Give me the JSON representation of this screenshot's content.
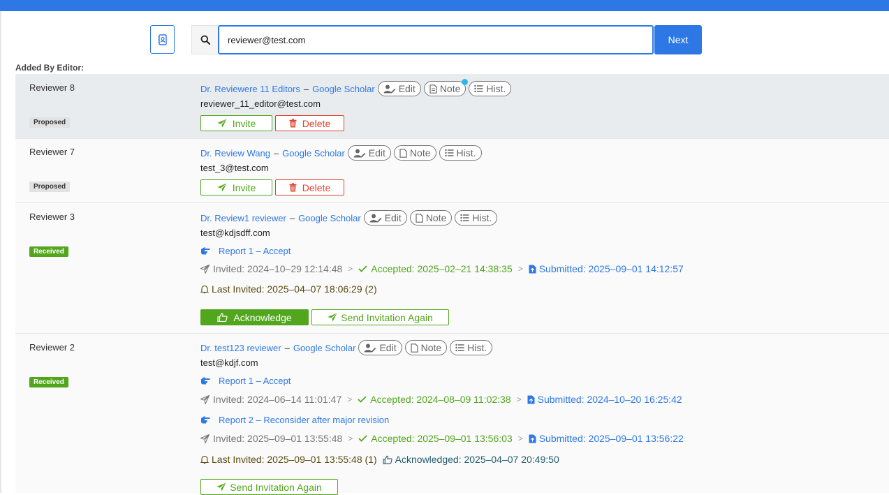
{
  "search": {
    "value": "reviewer@test.com",
    "next_label": "Next"
  },
  "section_label": "Added By Editor:",
  "common": {
    "google_scholar": "Google Scholar",
    "dash": "–",
    "edit": "Edit",
    "note": "Note",
    "hist": "Hist.",
    "invite": "Invite",
    "delete": "Delete",
    "acknowledge": "Acknowledge",
    "send_again": "Send Invitation Again"
  },
  "reviewers": [
    {
      "label": "Reviewer 8",
      "status": "Proposed",
      "name": "Dr. Reviewere 11 Editors",
      "email": "reviewer_11_editor@test.com"
    },
    {
      "label": "Reviewer 7",
      "status": "Proposed",
      "name": "Dr. Review Wang",
      "email": "test_3@test.com"
    },
    {
      "label": "Reviewer 3",
      "status": "Received",
      "name": "Dr. Review1 reviewer",
      "email": "test@kdjsdff.com",
      "reports": [
        {
          "title": "Report 1 – Accept",
          "invited": "Invited: 2024–10–29 12:14:48",
          "accepted": "Accepted: 2025–02–21 14:38:35",
          "submitted": "Submitted: 2025–09–01 14:12:57"
        }
      ],
      "last_invited": "Last Invited: 2025–04–07 18:06:29 (2)"
    },
    {
      "label": "Reviewer 2",
      "status": "Received",
      "name": "Dr. test123 reviewer",
      "email": "test@kdjf.com",
      "reports": [
        {
          "title": "Report 1 – Accept",
          "invited": "Invited: 2024–06–14 11:01:47",
          "accepted": "Accepted: 2024–08–09 11:02:38",
          "submitted": "Submitted: 2024–10–20 16:25:42"
        },
        {
          "title": "Report 2 – Reconsider after major revision",
          "invited": "Invited: 2025–09–01 13:55:48",
          "accepted": "Accepted: 2025–09–01 13:56:03",
          "submitted": "Submitted: 2025–09–01 13:56:22"
        }
      ],
      "last_invited": "Last Invited: 2025–09–01 13:55:48 (1)",
      "acknowledged": "Acknowledged: 2025–04–07 20:49:50"
    }
  ],
  "colors": {
    "primary": "#2d78e4",
    "success": "#52a61d",
    "danger": "#e0412e",
    "highlight_row": "#e9ecef",
    "notification_dot": "#30b6e8"
  },
  "icons": [
    "contact-book-icon",
    "search-icon",
    "user-edit-icon",
    "document-icon",
    "list-icon",
    "paper-plane-icon",
    "trash-icon",
    "hand-point-icon",
    "check-icon",
    "file-upload-icon",
    "bell-icon",
    "thumbs-up-icon",
    "chevron-right-icon"
  ]
}
